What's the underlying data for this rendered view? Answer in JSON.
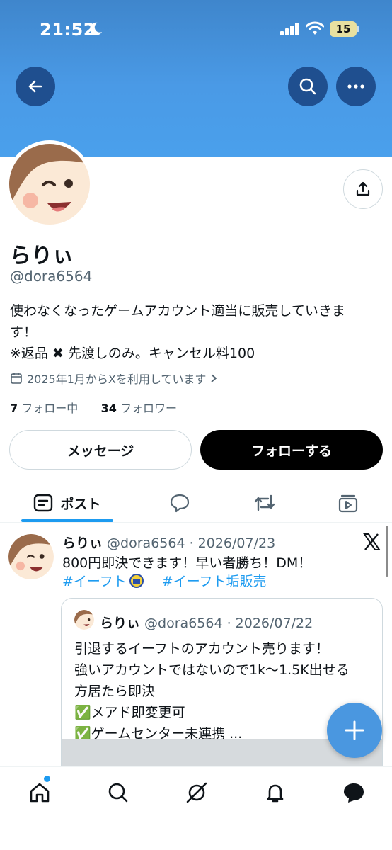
{
  "status_bar": {
    "time": "21:52",
    "battery": "15"
  },
  "profile": {
    "name": "らりぃ",
    "handle": "@dora6564",
    "bio_lines": [
      "使わなくなったゲームアカウント適当に販売していきま",
      "す！",
      "※返品 ✖ 先渡しのみ。キャンセル料100"
    ],
    "joined": "2025年1月からXを利用しています",
    "following_count": "7",
    "following_label": "フォロー中",
    "followers_count": "34",
    "followers_label": "フォロワー"
  },
  "actions": {
    "message_label": "メッセージ",
    "follow_label": "フォローする"
  },
  "tabs": {
    "posts_label": "ポスト"
  },
  "post": {
    "name": "らりぃ",
    "meta": " @dora6564 · 2026/07/23",
    "text": "800円即決できます！早い者勝ち！DM！",
    "hashtag1": "#イーフト",
    "hashtag2": "#イーフト垢販売",
    "quote": {
      "name": "らりぃ",
      "meta": " @dora6564 · 2026/07/22",
      "lines": [
        "引退するイーフトのアカウント売ります！",
        "強いアカウントではないので1k〜1.5K出せる",
        "方居たら即決",
        "✅メアド即変更可",
        "✅ゲームセンター未連携 ..."
      ]
    }
  },
  "colors": {
    "accent": "#1d9bf0",
    "header_blue": "#4a9ae6",
    "fab": "#4a97e0"
  },
  "icons": [
    "moon-icon",
    "signal-icon",
    "wifi-icon",
    "battery-icon",
    "back-arrow-icon",
    "search-icon",
    "more-icon",
    "share-icon",
    "calendar-icon",
    "chevron-right-icon",
    "posts-tab-icon",
    "replies-tab-icon",
    "reposts-tab-icon",
    "media-tab-icon",
    "x-logo-icon",
    "plus-icon",
    "home-icon",
    "explore-icon",
    "grok-icon",
    "notifications-icon",
    "messages-icon"
  ]
}
